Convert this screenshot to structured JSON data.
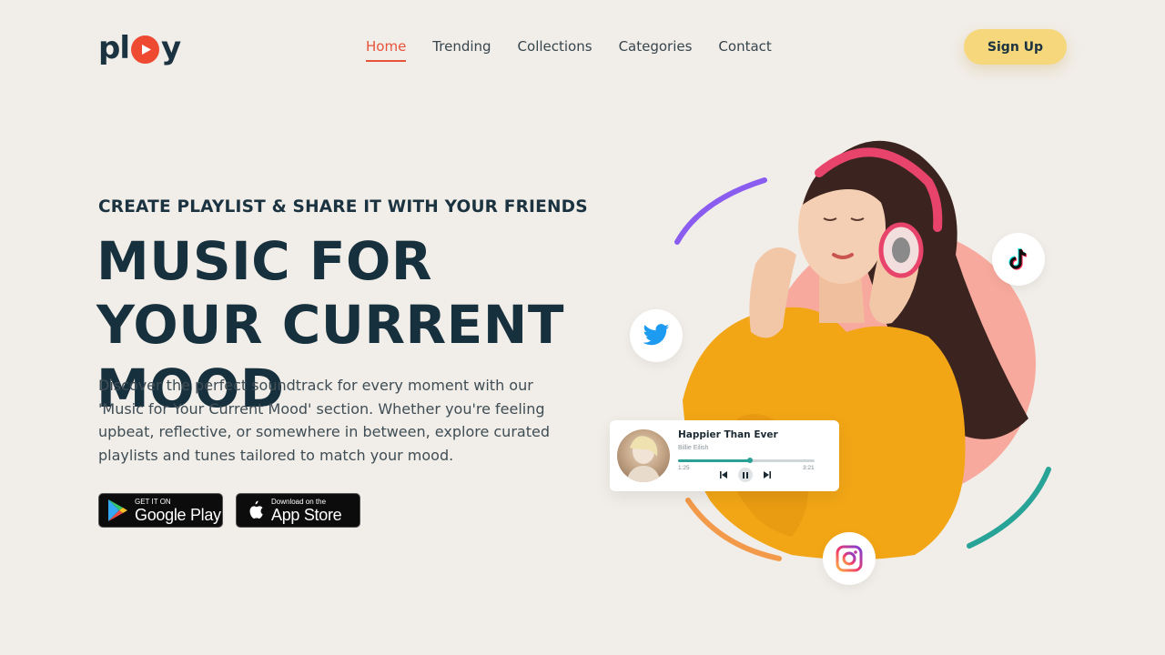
{
  "brand": {
    "logo_left": "pl",
    "logo_right": "y",
    "accent": "#ee4a32"
  },
  "nav": {
    "items": [
      {
        "label": "Home",
        "active": true
      },
      {
        "label": "Trending",
        "active": false
      },
      {
        "label": "Collections",
        "active": false
      },
      {
        "label": "Categories",
        "active": false
      },
      {
        "label": "Contact",
        "active": false
      }
    ]
  },
  "header": {
    "signup_label": "Sign Up"
  },
  "hero": {
    "kicker": "CREATE PLAYLIST & SHARE IT WITH YOUR FRIENDS",
    "headline": "MUSIC FOR YOUR CURRENT MOOD",
    "description": "Discover the perfect soundtrack for every moment with our 'Music for Your Current Mood' section. Whether you're feeling upbeat, reflective, or somewhere in between, explore curated playlists and tunes tailored to match your mood."
  },
  "stores": {
    "google": {
      "small": "GET IT ON",
      "big": "Google Play"
    },
    "apple": {
      "small": "Download on the",
      "big": "App Store"
    }
  },
  "player": {
    "title": "Happier Than Ever",
    "artist": "Billie Eilish",
    "elapsed": "1:25",
    "duration": "3:21",
    "progress": 0.53
  },
  "social": {
    "icons": [
      "twitter-icon",
      "tiktok-icon",
      "instagram-icon"
    ]
  },
  "colors": {
    "background": "#f1ede8",
    "signup": "#f6d77b",
    "blob": "#f8a99d",
    "arc_purple": "#8a5cf0",
    "arc_teal": "#27a497",
    "arc_orange": "#f29a4a"
  }
}
